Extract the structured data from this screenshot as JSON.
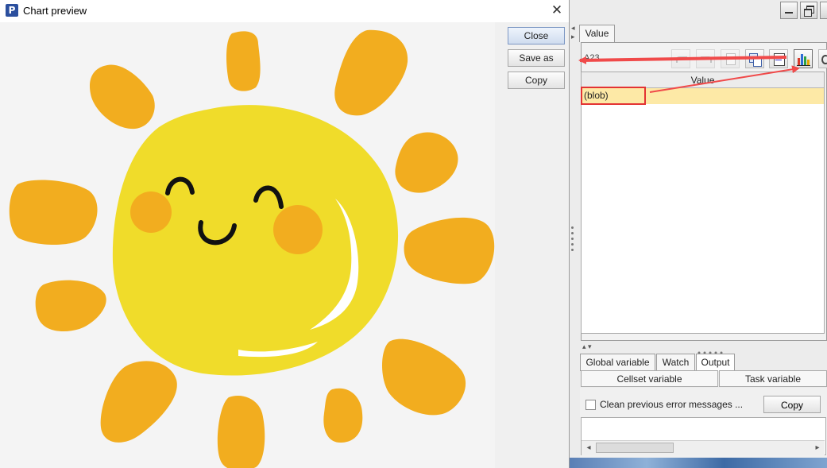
{
  "dialog": {
    "title": "Chart preview",
    "close_glyph": "✕",
    "buttons": {
      "close": "Close",
      "save_as": "Save as",
      "copy": "Copy"
    }
  },
  "ide": {
    "value_tab": "Value",
    "cell_ref": "A23",
    "grid": {
      "column_header": "Value",
      "rows": [
        "(blob)"
      ]
    },
    "bottom_tabs": [
      "Global variable",
      "Watch",
      "Output"
    ],
    "sub_tabs": [
      "Cellset variable",
      "Task variable"
    ],
    "output": {
      "checkbox_label": "Clean previous error messages ...",
      "copy_label": "Copy"
    }
  },
  "icons": {
    "app": "app-logo-icon",
    "chart": "chart-icon",
    "zoom": "zoom-icon",
    "arrow_color": "#f04a4a",
    "highlight_color": "#e33333"
  }
}
